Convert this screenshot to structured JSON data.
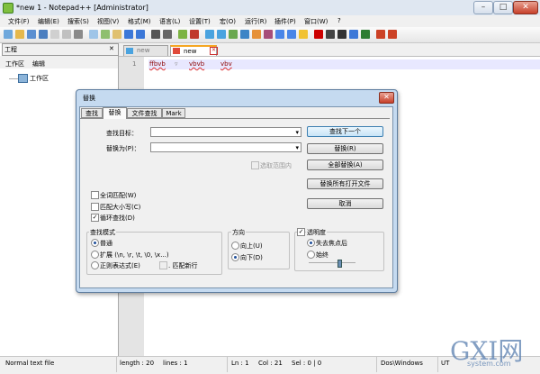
{
  "window": {
    "title": "*new  1 - Notepad++ [Administrator]",
    "minimize_glyph": "–",
    "maximize_glyph": "□",
    "close_glyph": "✕"
  },
  "menu": [
    "文件(F)",
    "编辑(E)",
    "搜索(S)",
    "视图(V)",
    "格式(M)",
    "语言(L)",
    "设置(T)",
    "宏(O)",
    "运行(R)",
    "插件(P)",
    "窗口(W)",
    "?"
  ],
  "toolbar_icons": [
    "new-file-icon",
    "open-file-icon",
    "save-icon",
    "save-all-icon",
    "close-icon",
    "close-all-icon",
    "print-icon",
    "cut-icon",
    "copy-icon",
    "paste-icon",
    "undo-icon",
    "redo-icon",
    "find-icon",
    "replace-icon",
    "zoom-in-icon",
    "zoom-out-icon",
    "sync-v-icon",
    "sync-h-icon",
    "wrap-icon",
    "all-chars-icon",
    "indent-guide-icon",
    "lang-icon",
    "doc-map-icon",
    "function-list-icon",
    "folder-icon",
    "record-icon",
    "stop-icon",
    "play-icon",
    "play-multi-icon",
    "save-macro-icon",
    "spell-icon",
    "spell-next-icon"
  ],
  "panel": {
    "title": "工程",
    "close_glyph": "✕",
    "menu": [
      "工作区",
      "编辑"
    ],
    "tree_root": "工作区"
  },
  "tabs": [
    {
      "label": "new",
      "active": false
    },
    {
      "label": "new",
      "active": true
    }
  ],
  "editor": {
    "line_number": "1",
    "code_words": [
      "ffbvb",
      "▿",
      "vbvb",
      "vbv"
    ]
  },
  "status": {
    "type": "Normal text file",
    "length": "length : 20",
    "lines": "lines : 1",
    "ln": "Ln : 1",
    "col": "Col : 21",
    "sel": "Sel : 0 | 0",
    "eol": "Dos\\Windows",
    "enc": "UT"
  },
  "dialog": {
    "title": "替换",
    "close_glyph": "✕",
    "tabs": [
      "查找",
      "替换",
      "文件查找",
      "Mark"
    ],
    "find_label": "查找目标：",
    "replace_label": "替换为(P)：",
    "combo_arrow": "▾",
    "in_selection": "选取范围内",
    "buttons": {
      "find_next": "查找下一个",
      "replace": "替换(R)",
      "replace_all": "全部替换(A)",
      "replace_all_open": "替换所有打开文件",
      "cancel": "取消"
    },
    "options": [
      {
        "label": "全词匹配(W)",
        "checked": false
      },
      {
        "label": "匹配大小写(C)",
        "checked": false
      },
      {
        "label": "循环查找(D)",
        "checked": true
      }
    ],
    "check_mark": "✓",
    "search_mode": {
      "title": "查找模式",
      "normal": "普通",
      "extended": "扩展 (\\n, \\r, \\t, \\0, \\x...)",
      "regex": "正则表达式(E)",
      "dot_newline": ". 匹配新行"
    },
    "direction": {
      "title": "方向",
      "up": "向上(U)",
      "down": "向下(D)"
    },
    "transparency": {
      "title": "透明度",
      "on_lose_focus": "失去焦点后",
      "always": "始终"
    }
  },
  "watermark": {
    "logo": "GXI网",
    "site": "system.com"
  }
}
